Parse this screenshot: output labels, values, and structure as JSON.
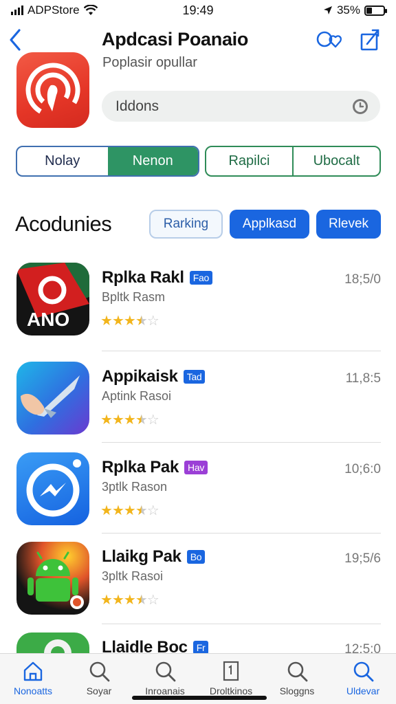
{
  "status": {
    "carrier": "ADPStore",
    "time": "19:49",
    "battery": "35%",
    "battery_level": 0.35
  },
  "header": {
    "title": "Apdcasi Poanaio",
    "back_icon": "chevron-left-icon",
    "icons": [
      "search-heart-icon",
      "share-icon"
    ]
  },
  "hero": {
    "subtitle": "Poplasir opullar",
    "search_value": "Iddons"
  },
  "segments": {
    "left": [
      {
        "label": "Nolay",
        "active": false
      },
      {
        "label": "Nenon",
        "active": true
      }
    ],
    "right": [
      {
        "label": "Rapilci"
      },
      {
        "label": "Ubocalt"
      }
    ]
  },
  "section": {
    "title": "Acodunies",
    "chips": [
      {
        "label": "Rarking"
      },
      {
        "label": "Applkasd"
      },
      {
        "label": "Rlevek"
      }
    ]
  },
  "apps": [
    {
      "name": "Rplka Rakl",
      "badge": "Fao",
      "badge_color": "#1a66e0",
      "sub": "Bpltk Rasm",
      "meta": "18;5/0",
      "rating": 3.5
    },
    {
      "name": "Appikaisk",
      "badge": "Tad",
      "badge_color": "#1a66e0",
      "sub": "Aptink Rasoi",
      "meta": "11,8:5",
      "rating": 3.5
    },
    {
      "name": "Rplka Pak",
      "badge": "Hav",
      "badge_color": "#9b3fd6",
      "sub": "3ptlk Rason",
      "meta": "10;6:0",
      "rating": 3.5
    },
    {
      "name": "Llaikg Pak",
      "badge": "Bo",
      "badge_color": "#1a66e0",
      "sub": "3pltk Rasoi",
      "meta": "19;5/6",
      "rating": 3.5
    },
    {
      "name": "Llaidle Boc",
      "badge": "Fr",
      "badge_color": "#1a66e0",
      "sub": "",
      "meta": "12;5:0",
      "rating": 0
    }
  ],
  "tabs": [
    {
      "label": "Nonoatts",
      "icon": "home-icon",
      "active": true
    },
    {
      "label": "Soyar",
      "icon": "search-icon",
      "active": false
    },
    {
      "label": "Inroanais",
      "icon": "search-icon",
      "active": false
    },
    {
      "label": "Droltkinos",
      "icon": "book-icon",
      "active": false
    },
    {
      "label": "Sloggns",
      "icon": "search-icon",
      "active": false
    },
    {
      "label": "Uldevar",
      "icon": "search-icon",
      "active": true
    }
  ]
}
